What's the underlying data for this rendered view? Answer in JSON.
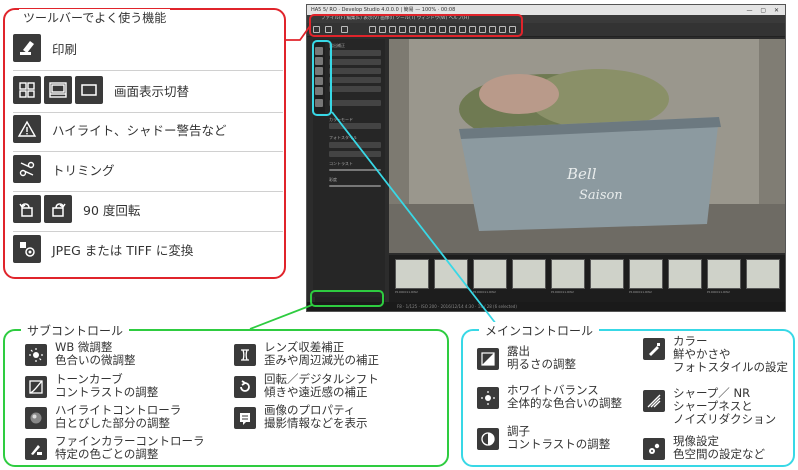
{
  "toolbar_panel": {
    "title": "ツールバーでよく使う機能",
    "rows": [
      {
        "label": "印刷",
        "icon": "print-icon"
      },
      {
        "label": "画面表示切替",
        "icon": "view-switch-icon"
      },
      {
        "label": "ハイライト、シャドー警告など",
        "icon": "warning-icon"
      },
      {
        "label": "トリミング",
        "icon": "crop-icon"
      },
      {
        "label": "90 度回転",
        "icon": "rotate-icon"
      },
      {
        "label": "JPEG または TIFF に変換",
        "icon": "convert-icon"
      }
    ]
  },
  "app": {
    "window_title": "HA5 5/ RO · Develop Studio 4.0.0.0 | 簡易 — 100% · 00:08",
    "menu": "ファイル(F)  編集(E)  表示(V)  画像(I)  ツール(T)  ウィンドウ(W)  ヘルプ(H)",
    "sidebar_labels": [
      "露出補正",
      "ピクチャーモード",
      "コントラスト",
      "カラーモード",
      "フォトスタイル",
      "フォトスタイル",
      "ナチュラル",
      "コントラスト",
      "彩度"
    ],
    "status": "F8 · 1/125 · ISO 200 · 2016/12/14  4:30 · 14 / 28 (6 selected)",
    "thumb_caption": "P1000011.RW2"
  },
  "sub_panel": {
    "title": "サブコントロール",
    "items": [
      {
        "title": "WB 微調整",
        "desc": "色合いの微調整",
        "icon": "wb-fine-icon"
      },
      {
        "title": "トーンカーブ",
        "desc": "コントラストの調整",
        "icon": "tone-curve-icon"
      },
      {
        "title": "ハイライトコントローラ",
        "desc": "白とびした部分の調整",
        "icon": "highlight-icon"
      },
      {
        "title": "ファインカラーコントローラ",
        "desc": "特定の色ごとの調整",
        "icon": "fine-color-icon"
      },
      {
        "title": "レンズ収差補正",
        "desc": "歪みや周辺減光の補正",
        "icon": "lens-icon"
      },
      {
        "title": "回転／デジタルシフト",
        "desc": "傾きや遠近感の補正",
        "icon": "rotate-shift-icon"
      },
      {
        "title": "画像のプロパティ",
        "desc": "撮影情報などを表示",
        "icon": "properties-icon"
      }
    ]
  },
  "main_panel": {
    "title": "メインコントロール",
    "items": [
      {
        "title": "露出",
        "desc": "明るさの調整",
        "icon": "exposure-icon"
      },
      {
        "title": "ホワイトバランス",
        "desc": "全体的な色合いの調整",
        "icon": "white-balance-icon"
      },
      {
        "title": "調子",
        "desc": "コントラストの調整",
        "icon": "tone-icon"
      },
      {
        "title": "カラー",
        "desc": "鮮やかさや\nフォトスタイルの設定",
        "icon": "color-icon"
      },
      {
        "title": "シャープ／ NR",
        "desc": "シャープネスと\nノイズリダクション",
        "icon": "sharp-nr-icon"
      },
      {
        "title": "現像設定",
        "desc": "色空間の設定など",
        "icon": "develop-settings-icon"
      }
    ]
  },
  "colors": {
    "red": "#e0242b",
    "green": "#2ecc40",
    "cyan": "#38d8e6"
  }
}
